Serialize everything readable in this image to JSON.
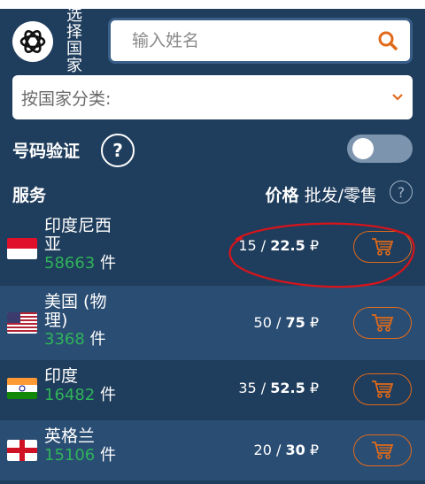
{
  "header": {
    "select_country_label": "选择国家",
    "search_placeholder": "输入姓名",
    "category_dropdown_label": "按国家分类:"
  },
  "verify": {
    "label": "号码验证",
    "help": "?",
    "toggle_on": false
  },
  "table": {
    "service_header": "服务",
    "price_header": "价格",
    "price_mode": "批发/零售",
    "help": "?",
    "rows": [
      {
        "country": "印度尼西亚",
        "count": "58663",
        "unit": "件",
        "wholesale": "15",
        "retail": "22.5",
        "currency": "₽",
        "flag": "indonesia-flag"
      },
      {
        "country": "美国 (物理)",
        "count": "3368",
        "unit": "件",
        "wholesale": "50",
        "retail": "75",
        "currency": "₽",
        "flag": "usa-flag"
      },
      {
        "country": "印度",
        "count": "16482",
        "unit": "件",
        "wholesale": "35",
        "retail": "52.5",
        "currency": "₽",
        "flag": "india-flag"
      },
      {
        "country": "英格兰",
        "count": "15106",
        "unit": "件",
        "wholesale": "20",
        "retail": "30",
        "currency": "₽",
        "flag": "england-flag"
      }
    ]
  },
  "colors": {
    "background": "#1f3d5c",
    "row_alt": "#2a4d73",
    "count_green": "#2fb35a",
    "accent_orange": "#e06a1a",
    "annotation_red": "#d8141b"
  }
}
